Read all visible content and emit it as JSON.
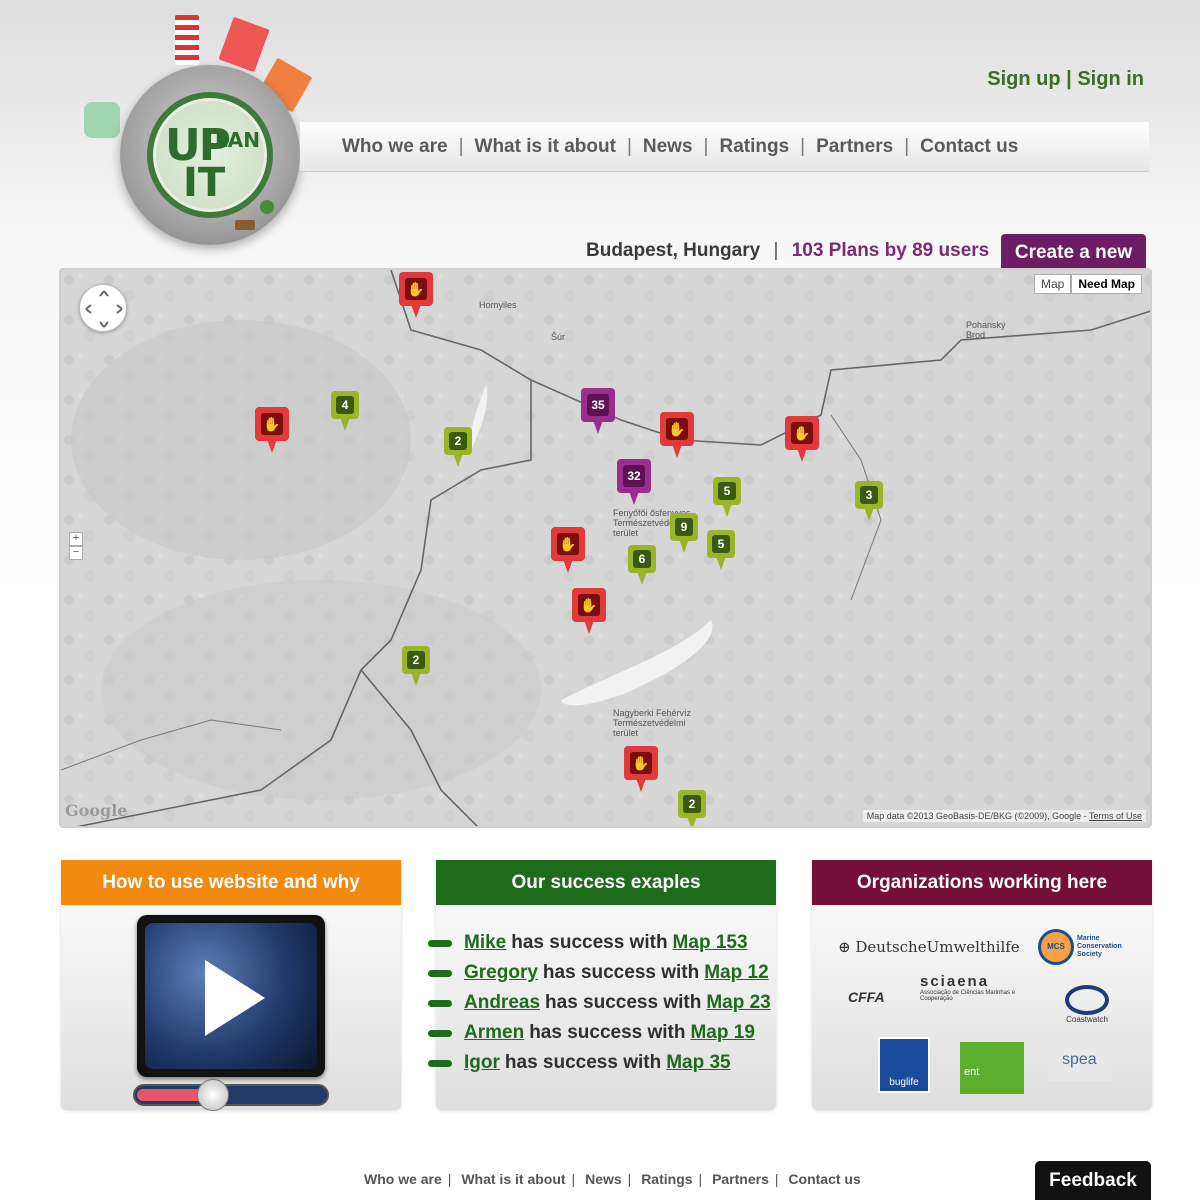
{
  "logo": {
    "text_up": "UP",
    "text_lan": "LAN",
    "text_it": "IT"
  },
  "header": {
    "sign_up": "Sign up",
    "separator": "|",
    "sign_in": "Sign in",
    "nav": [
      "Who we are",
      "What is it about",
      "News",
      "Ratings",
      "Partners",
      "Contact us"
    ]
  },
  "stats": {
    "city": "Budapest, Hungary",
    "separator": "|",
    "plans": "103 Plans by 89 users",
    "create_button": "Create a new"
  },
  "map": {
    "type_options": [
      "Map",
      "Need Map"
    ],
    "selected_type": "Need Map",
    "zoom_in": "+",
    "zoom_out": "−",
    "google": "Google",
    "credit": "Map data ©2013 GeoBasis-DE/BKG (©2009), Google - ",
    "terms": "Terms of Use",
    "places": [
      "Hornyiles",
      "Šúr",
      "Pohanský Brod",
      "Fenyőfői ősfenyves Természetvédelmi terület",
      "Nagyberki Fehérvíz Természetvédelmi terület"
    ],
    "markers": [
      {
        "kind": "red",
        "label": "✋"
      },
      {
        "kind": "red",
        "label": "✋"
      },
      {
        "kind": "green",
        "label": "4"
      },
      {
        "kind": "green",
        "label": "2"
      },
      {
        "kind": "purple",
        "label": "35"
      },
      {
        "kind": "red",
        "label": "✋"
      },
      {
        "kind": "red",
        "label": "✋"
      },
      {
        "kind": "purple",
        "label": "32"
      },
      {
        "kind": "green",
        "label": "5"
      },
      {
        "kind": "green",
        "label": "3"
      },
      {
        "kind": "green",
        "label": "9"
      },
      {
        "kind": "red",
        "label": "✋"
      },
      {
        "kind": "green",
        "label": "6"
      },
      {
        "kind": "green",
        "label": "5"
      },
      {
        "kind": "red",
        "label": "✋"
      },
      {
        "kind": "green",
        "label": "2"
      },
      {
        "kind": "red",
        "label": "✋"
      },
      {
        "kind": "green",
        "label": "2"
      }
    ]
  },
  "panels": {
    "how_to": {
      "title": "How to use website and why"
    },
    "success": {
      "title": "Our success exaples",
      "items": [
        {
          "user": "Mike",
          "mid": "has success with",
          "map": "Map 153"
        },
        {
          "user": "Gregory",
          "mid": "has success with",
          "map": "Map 12"
        },
        {
          "user": "Andreas",
          "mid": "has success with",
          "map": "Map 23"
        },
        {
          "user": "Armen",
          "mid": "has success with",
          "map": "Map 19"
        },
        {
          "user": "Igor",
          "mid": "has success with",
          "map": "Map 35"
        }
      ]
    },
    "orgs": {
      "title": "Organizations working here",
      "logos": [
        "DeutscheUmwelthilfe",
        "Marine Conservation Society",
        "MCS",
        "sciaena",
        "Associação de Ciências Marinhas e Cooperação",
        "CFFA",
        "Coastwatch",
        "buglife",
        "ent",
        "spea"
      ]
    }
  },
  "footer": {
    "links": [
      "Who we are",
      "What is it about",
      "News",
      "Ratings",
      "Partners",
      "Contact us"
    ],
    "feedback": "Feedback"
  },
  "colors": {
    "brand_green": "#3c6e26",
    "purple": "#6d1d63",
    "orange": "#f28a12",
    "maroon": "#741038"
  }
}
